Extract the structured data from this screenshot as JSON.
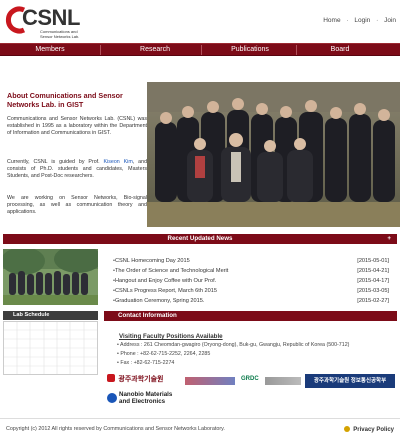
{
  "header": {
    "logo_text": "CSNL",
    "logo_sub_1": "Communications and",
    "logo_sub_2": "Sensor Networks Lab.",
    "links": [
      "Home",
      "Login",
      "Join"
    ]
  },
  "nav": {
    "items": [
      "Members",
      "Research",
      "Publications",
      "Board"
    ]
  },
  "intro": {
    "title": "About Comunications and Sensor Networks Lab. in GIST",
    "p1": "Communications and Sensor Networks Lab. (CSNL) was established in 1995 as a laboratory within the Department of Information and Communications in GIST.",
    "p2_a": "Currently, CSNL is guided by Prof. ",
    "p2_link": "Kiseon Kim",
    "p2_b": ", and consists of Ph.D. students and candidates, Masters Students, and Post-Doc researchers.",
    "p3": "We are working on Sensor Networks, Bio-signal processing, as well as communication theory and applications."
  },
  "news": {
    "bar_label": "Recent Updated News",
    "more_label": "+",
    "items": [
      {
        "title": "CSNL Homecoming Day 2015",
        "date": "[2015-05-01]"
      },
      {
        "title": "The Order of Science and Technological Merit",
        "date": "[2015-04-21]"
      },
      {
        "title": "Hangout and Enjoy Coffee with Our Prof.",
        "date": "[2015-04-17]"
      },
      {
        "title": "CSNLs Progress Report, March 6th 2015",
        "date": "[2015-03-05]"
      },
      {
        "title": "Graduation Ceremony, Spring 2015.",
        "date": "[2015-02-27]"
      }
    ]
  },
  "schedule": {
    "label": "Lab Schedule"
  },
  "contact": {
    "bar_label": "Contact Information",
    "heading": "Visiting Faculty Positions Available",
    "address": "Address : 261 Cheomdan-gwagiro (Oryong-dong), Buk-gu, Gwangju, Republic of Korea (500-712)",
    "phone": "Phone : +82-62-715-2252, 2264, 2285",
    "fax": "Fax : +82-62-715-2274"
  },
  "partners": {
    "gist": "광주과학기술원",
    "nanobio_1": "Nanobio Materials",
    "nanobio_2": "and Electronics",
    "grdc": "GRDC",
    "gist_info": "광주과학기술원 정보통신공학부"
  },
  "footer": {
    "copyright": "Copyright (c) 2012 All rights reserved by Communications and Sensor Networks Laboratory.",
    "privacy": "Privacy Policy"
  },
  "colors": {
    "primary": "#7c0b18",
    "schedule_bar": "#3d3d3d",
    "link": "#1a56b8"
  }
}
